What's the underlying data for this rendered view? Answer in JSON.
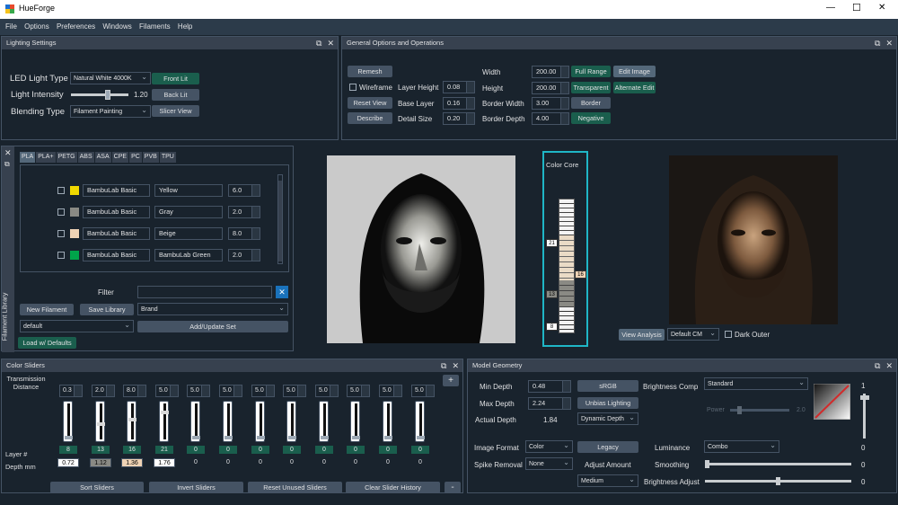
{
  "app": {
    "title": "HueForge"
  },
  "menu": [
    "File",
    "Options",
    "Preferences",
    "Windows",
    "Filaments",
    "Help"
  ],
  "window_controls": {
    "minimize": "—",
    "maximize": "☐",
    "close": "✕"
  },
  "lighting": {
    "title": "Lighting Settings",
    "led_label": "LED Light Type",
    "led_value": "Natural White 4000K",
    "intensity_label": "Light Intensity",
    "intensity_value": "1.20",
    "intensity_fraction": 0.65,
    "blending_label": "Blending Type",
    "blending_value": "Filament Painting",
    "front_lit": "Front Lit",
    "back_lit": "Back Lit",
    "slicer_view": "Slicer View"
  },
  "general": {
    "title": "General Options and Operations",
    "remesh": "Remesh",
    "wireframe": "Wireframe",
    "reset_view": "Reset View",
    "describe": "Describe",
    "layer_height_label": "Layer Height",
    "layer_height": "0.08",
    "base_layer_label": "Base Layer",
    "base_layer": "0.16",
    "detail_size_label": "Detail Size",
    "detail_size": "0.20",
    "width_label": "Width",
    "width": "200.00",
    "height_label": "Height",
    "height": "200.00",
    "border_width_label": "Border Width",
    "border_width": "3.00",
    "border_depth_label": "Border Depth",
    "border_depth": "4.00",
    "full_range": "Full Range",
    "edit_image": "Edit Image",
    "transparent": "Transparent",
    "alternate_edit": "Alternate Edit",
    "border": "Border",
    "negative": "Negative"
  },
  "filament_library": {
    "side_title": "Filament Library",
    "tabs": [
      "PLA",
      "PLA+",
      "PETG",
      "ABS",
      "ASA",
      "CPE",
      "PC",
      "PVB",
      "TPU"
    ],
    "rows": [
      {
        "brand": "BambuLab Basic",
        "name": "Yellow",
        "td": "6.0",
        "color": "#f0d800"
      },
      {
        "brand": "BambuLab Basic",
        "name": "Gray",
        "td": "2.0",
        "color": "#8a8a84"
      },
      {
        "brand": "BambuLab Basic",
        "name": "Beige",
        "td": "8.0",
        "color": "#efd3b5"
      },
      {
        "brand": "BambuLab Basic",
        "name": "BambuLab Green",
        "td": "2.0",
        "color": "#00a44a"
      }
    ],
    "filter_label": "Filter",
    "new_filament": "New Filament",
    "save_library": "Save Library",
    "brand_value": "Brand",
    "set_value": "default",
    "add_update_set": "Add/Update Set",
    "load_defaults": "Load w/ Defaults"
  },
  "viewer": {
    "color_core_label": "Color Core",
    "core_markers": [
      "21",
      "16",
      "13",
      "8"
    ],
    "view_analysis": "View Analysis",
    "cm_value": "Default CM",
    "dark_outer": "Dark Outer"
  },
  "color_sliders": {
    "title": "Color Sliders",
    "transmission_label": "Transmission\nDistance",
    "layer_label": "Layer #",
    "depth_label": "Depth mm",
    "td_values": [
      "0.3",
      "2.0",
      "8.0",
      "5.0",
      "5.0",
      "5.0",
      "5.0",
      "5.0",
      "5.0",
      "5.0",
      "5.0",
      "5.0"
    ],
    "layers": [
      "8",
      "13",
      "16",
      "21",
      "0",
      "0",
      "0",
      "0",
      "0",
      "0",
      "0",
      "0"
    ],
    "slider_levels": [
      0.0,
      0.45,
      0.6,
      0.82,
      0,
      0,
      0,
      0,
      0,
      0,
      0,
      0
    ],
    "depths": [
      "0.72",
      "1.12",
      "1.36",
      "1.76",
      "0",
      "0",
      "0",
      "0",
      "0",
      "0",
      "0",
      "0"
    ],
    "depth_colors": [
      "#ffffff",
      "#8a8a84",
      "#efd3b5",
      "#ffffff"
    ],
    "sort": "Sort Sliders",
    "invert": "Invert Sliders",
    "reset_unused": "Reset Unused Sliders",
    "clear_history": "Clear Slider History",
    "plus": "+",
    "minus": "-"
  },
  "model_geometry": {
    "title": "Model Geometry",
    "min_depth_label": "Min Depth",
    "min_depth": "0.48",
    "max_depth_label": "Max Depth",
    "max_depth": "2.24",
    "actual_depth_label": "Actual Depth",
    "actual_depth": "1.84",
    "srgb": "sRGB",
    "unbias_lighting": "Unbias Lighting",
    "dynamic_depth": "Dynamic Depth",
    "brightness_comp_label": "Brightness Comp",
    "brightness_comp": "Standard",
    "power_label": "Power",
    "power_value": "2.0",
    "image_format_label": "Image Format",
    "image_format": "Color",
    "legacy": "Legacy",
    "spike_removal_label": "Spike Removal",
    "spike_removal": "None",
    "adjust_amount_label": "Adjust Amount",
    "adjust_amount": "Medium",
    "luminance_label": "Luminance",
    "luminance": "Combo",
    "smoothing_label": "Smoothing",
    "smoothing_value": "0",
    "brightness_adjust_label": "Brightness Adjust",
    "brightness_adjust_value": "0",
    "vertical_top": "1",
    "vertical_bottom": "0"
  }
}
